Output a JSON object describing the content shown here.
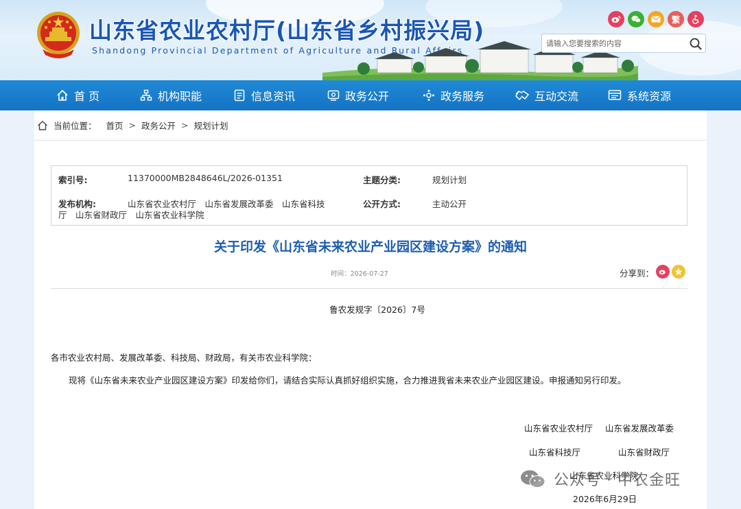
{
  "header": {
    "site_title": "山东省农业农村厅(山东省乡村振兴局)",
    "site_subtitle": "Shandong Provincial Department of Agriculture and Rural Affairs",
    "search_placeholder": "请输入您要搜索的内容",
    "social": [
      {
        "name": "weibo",
        "color": "#e6405f",
        "glyph": ""
      },
      {
        "name": "wechat",
        "color": "#3cb034",
        "glyph": ""
      },
      {
        "name": "mail",
        "color": "#f5a623",
        "glyph": ""
      },
      {
        "name": "traditional",
        "color": "#e8605a",
        "glyph": "繁"
      },
      {
        "name": "accessibility",
        "color": "#e6405f",
        "glyph": ""
      }
    ]
  },
  "nav": {
    "items": [
      {
        "label": "首 页",
        "icon": "home-icon"
      },
      {
        "label": "机构职能",
        "icon": "org-chart-icon"
      },
      {
        "label": "信息资讯",
        "icon": "document-icon"
      },
      {
        "label": "政务公开",
        "icon": "monitor-icon"
      },
      {
        "label": "政务服务",
        "icon": "service-icon"
      },
      {
        "label": "互动交流",
        "icon": "handshake-icon"
      },
      {
        "label": "系统资源",
        "icon": "system-icon"
      }
    ]
  },
  "breadcrumb": {
    "prefix": "当前位置：",
    "items": [
      "首页",
      "政务公开",
      "规划计划"
    ],
    "separator": ">"
  },
  "meta": {
    "index_label": "索引号:",
    "index_value": "11370000MB2848646L/2026-01351",
    "topic_label": "主题分类:",
    "topic_value": "规划计划",
    "publisher_label": "发布机构:",
    "publisher_line1": "山东省农业农村厅　山东省发展改革委　山东省科技",
    "publisher_line2": "厅　山东省财政厅　山东省农业科学院",
    "open_label": "公开方式:",
    "open_value": "主动公开"
  },
  "article": {
    "title": "关于印发《山东省未来农业产业园区建设方案》的通知",
    "date": "时间：2026-07-27",
    "share_label": "分享到：",
    "doc_number": "鲁农发规字〔2026〕7号",
    "salutation": "各市农业农村局、发展改革委、科技局、财政局，有关市农业科学院：",
    "paragraph": "现将《山东省未来农业产业园区建设方案》印发给你们，请结合实际认真抓好组织实施，合力推进我省未来农业产业园区建设。申报通知另行印发。",
    "signatures": {
      "s1": "山东省农业农村厅",
      "s2": "山东省发展改革委",
      "s3": "山东省科技厅",
      "s4": "山东省财政厅",
      "s5": "山东省农业科学院",
      "date": "2026年6月29日"
    }
  },
  "watermark": {
    "text": "公众号 · 中农金旺"
  },
  "colors": {
    "nav_bg": "#1573c4",
    "title_blue": "#1c5db0",
    "header_title": "#1a56b4"
  }
}
